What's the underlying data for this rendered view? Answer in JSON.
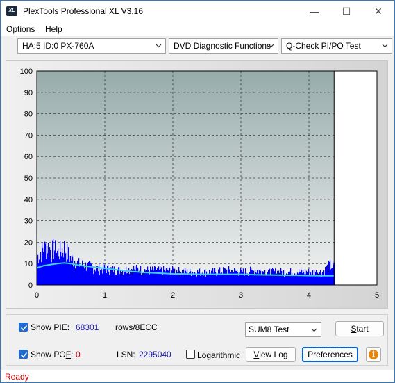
{
  "window": {
    "title": "PlexTools Professional XL V3.16",
    "icon_text": "XL",
    "controls": {
      "minimize": "—",
      "maximize": "☐",
      "close": "✕"
    }
  },
  "menu": {
    "items": [
      {
        "label": "Options",
        "accel": "O",
        "rest": "ptions"
      },
      {
        "label": "Help",
        "accel": "H",
        "rest": "elp"
      }
    ]
  },
  "toolbar": {
    "drive": "HA:5 ID:0  PX-760A",
    "function": "DVD Diagnostic Functions",
    "test": "Q-Check PI/PO Test"
  },
  "chart_data": {
    "type": "bar",
    "xlim": [
      0,
      5
    ],
    "ylim": [
      0,
      100
    ],
    "x_ticks": [
      "0",
      "1",
      "2",
      "3",
      "4",
      "5"
    ],
    "y_ticks": [
      "0",
      "10",
      "20",
      "30",
      "40",
      "50",
      "60",
      "70",
      "80",
      "90",
      "100"
    ],
    "grid": true,
    "data_end_x": 4.37,
    "series": [
      {
        "kind": "bars",
        "color": "#0000ff",
        "envelope": [
          [
            0.0,
            17
          ],
          [
            0.05,
            20
          ],
          [
            0.1,
            22
          ],
          [
            0.15,
            24
          ],
          [
            0.2,
            21
          ],
          [
            0.25,
            22
          ],
          [
            0.3,
            20
          ],
          [
            0.35,
            21
          ],
          [
            0.4,
            23
          ],
          [
            0.45,
            19
          ],
          [
            0.5,
            16
          ],
          [
            0.55,
            15
          ],
          [
            0.6,
            13
          ],
          [
            0.7,
            12
          ],
          [
            0.8,
            11
          ],
          [
            0.9,
            10
          ],
          [
            1.0,
            10
          ],
          [
            1.2,
            9
          ],
          [
            1.4,
            10
          ],
          [
            1.6,
            9
          ],
          [
            1.8,
            9
          ],
          [
            2.0,
            9
          ],
          [
            2.2,
            8
          ],
          [
            2.4,
            8
          ],
          [
            2.6,
            8
          ],
          [
            2.8,
            9
          ],
          [
            3.0,
            8
          ],
          [
            3.2,
            9
          ],
          [
            3.4,
            8
          ],
          [
            3.6,
            8
          ],
          [
            3.8,
            8
          ],
          [
            4.0,
            8
          ],
          [
            4.2,
            8
          ],
          [
            4.3,
            12
          ],
          [
            4.37,
            11
          ]
        ]
      },
      {
        "kind": "average-line",
        "color": "#40d0e0",
        "points": [
          [
            0.0,
            8
          ],
          [
            0.1,
            9
          ],
          [
            0.2,
            9.5
          ],
          [
            0.3,
            10
          ],
          [
            0.4,
            10.3
          ],
          [
            0.5,
            10
          ],
          [
            0.6,
            9.3
          ],
          [
            0.8,
            8.5
          ],
          [
            1.0,
            7.8
          ],
          [
            1.2,
            7
          ],
          [
            1.4,
            6.3
          ],
          [
            1.6,
            5.8
          ],
          [
            1.8,
            5.5
          ],
          [
            2.0,
            5.2
          ],
          [
            2.2,
            5.1
          ],
          [
            2.4,
            5
          ],
          [
            2.6,
            5
          ],
          [
            2.8,
            5
          ],
          [
            3.0,
            5
          ],
          [
            3.2,
            4.8
          ],
          [
            3.4,
            4.7
          ],
          [
            3.6,
            4.6
          ],
          [
            3.8,
            4.5
          ],
          [
            4.0,
            4.4
          ],
          [
            4.2,
            4.3
          ],
          [
            4.37,
            4.3
          ]
        ]
      }
    ]
  },
  "bottom": {
    "show_pie_label": "Show PIE:",
    "show_pie_checked": true,
    "pie_value": "68301",
    "pie_unit": "rows/8ECC",
    "show_pof_label_pre": "Show PO",
    "show_pof_label_accel": "F",
    "show_pof_label_post": ":",
    "show_pof_checked": true,
    "pof_value": "0",
    "lsn_label": "LSN:",
    "lsn_value": "2295040",
    "logarithmic_label": "Logarithmic",
    "logarithmic_checked": false,
    "sum_select": "SUM8 Test",
    "start_accel": "S",
    "start_rest": "tart",
    "viewlog_accel": "V",
    "viewlog_rest": "iew Log",
    "preferences_label": "Preferences",
    "info_glyph": "i"
  },
  "status": {
    "text": "Ready"
  },
  "colors": {
    "plot_bg_top": "#97abab",
    "plot_bg_bottom": "#f2f2f2",
    "bars": "#0000ff",
    "average": "#40d0e0",
    "status_text": "#d00000",
    "accent": "#1f6bd1"
  }
}
